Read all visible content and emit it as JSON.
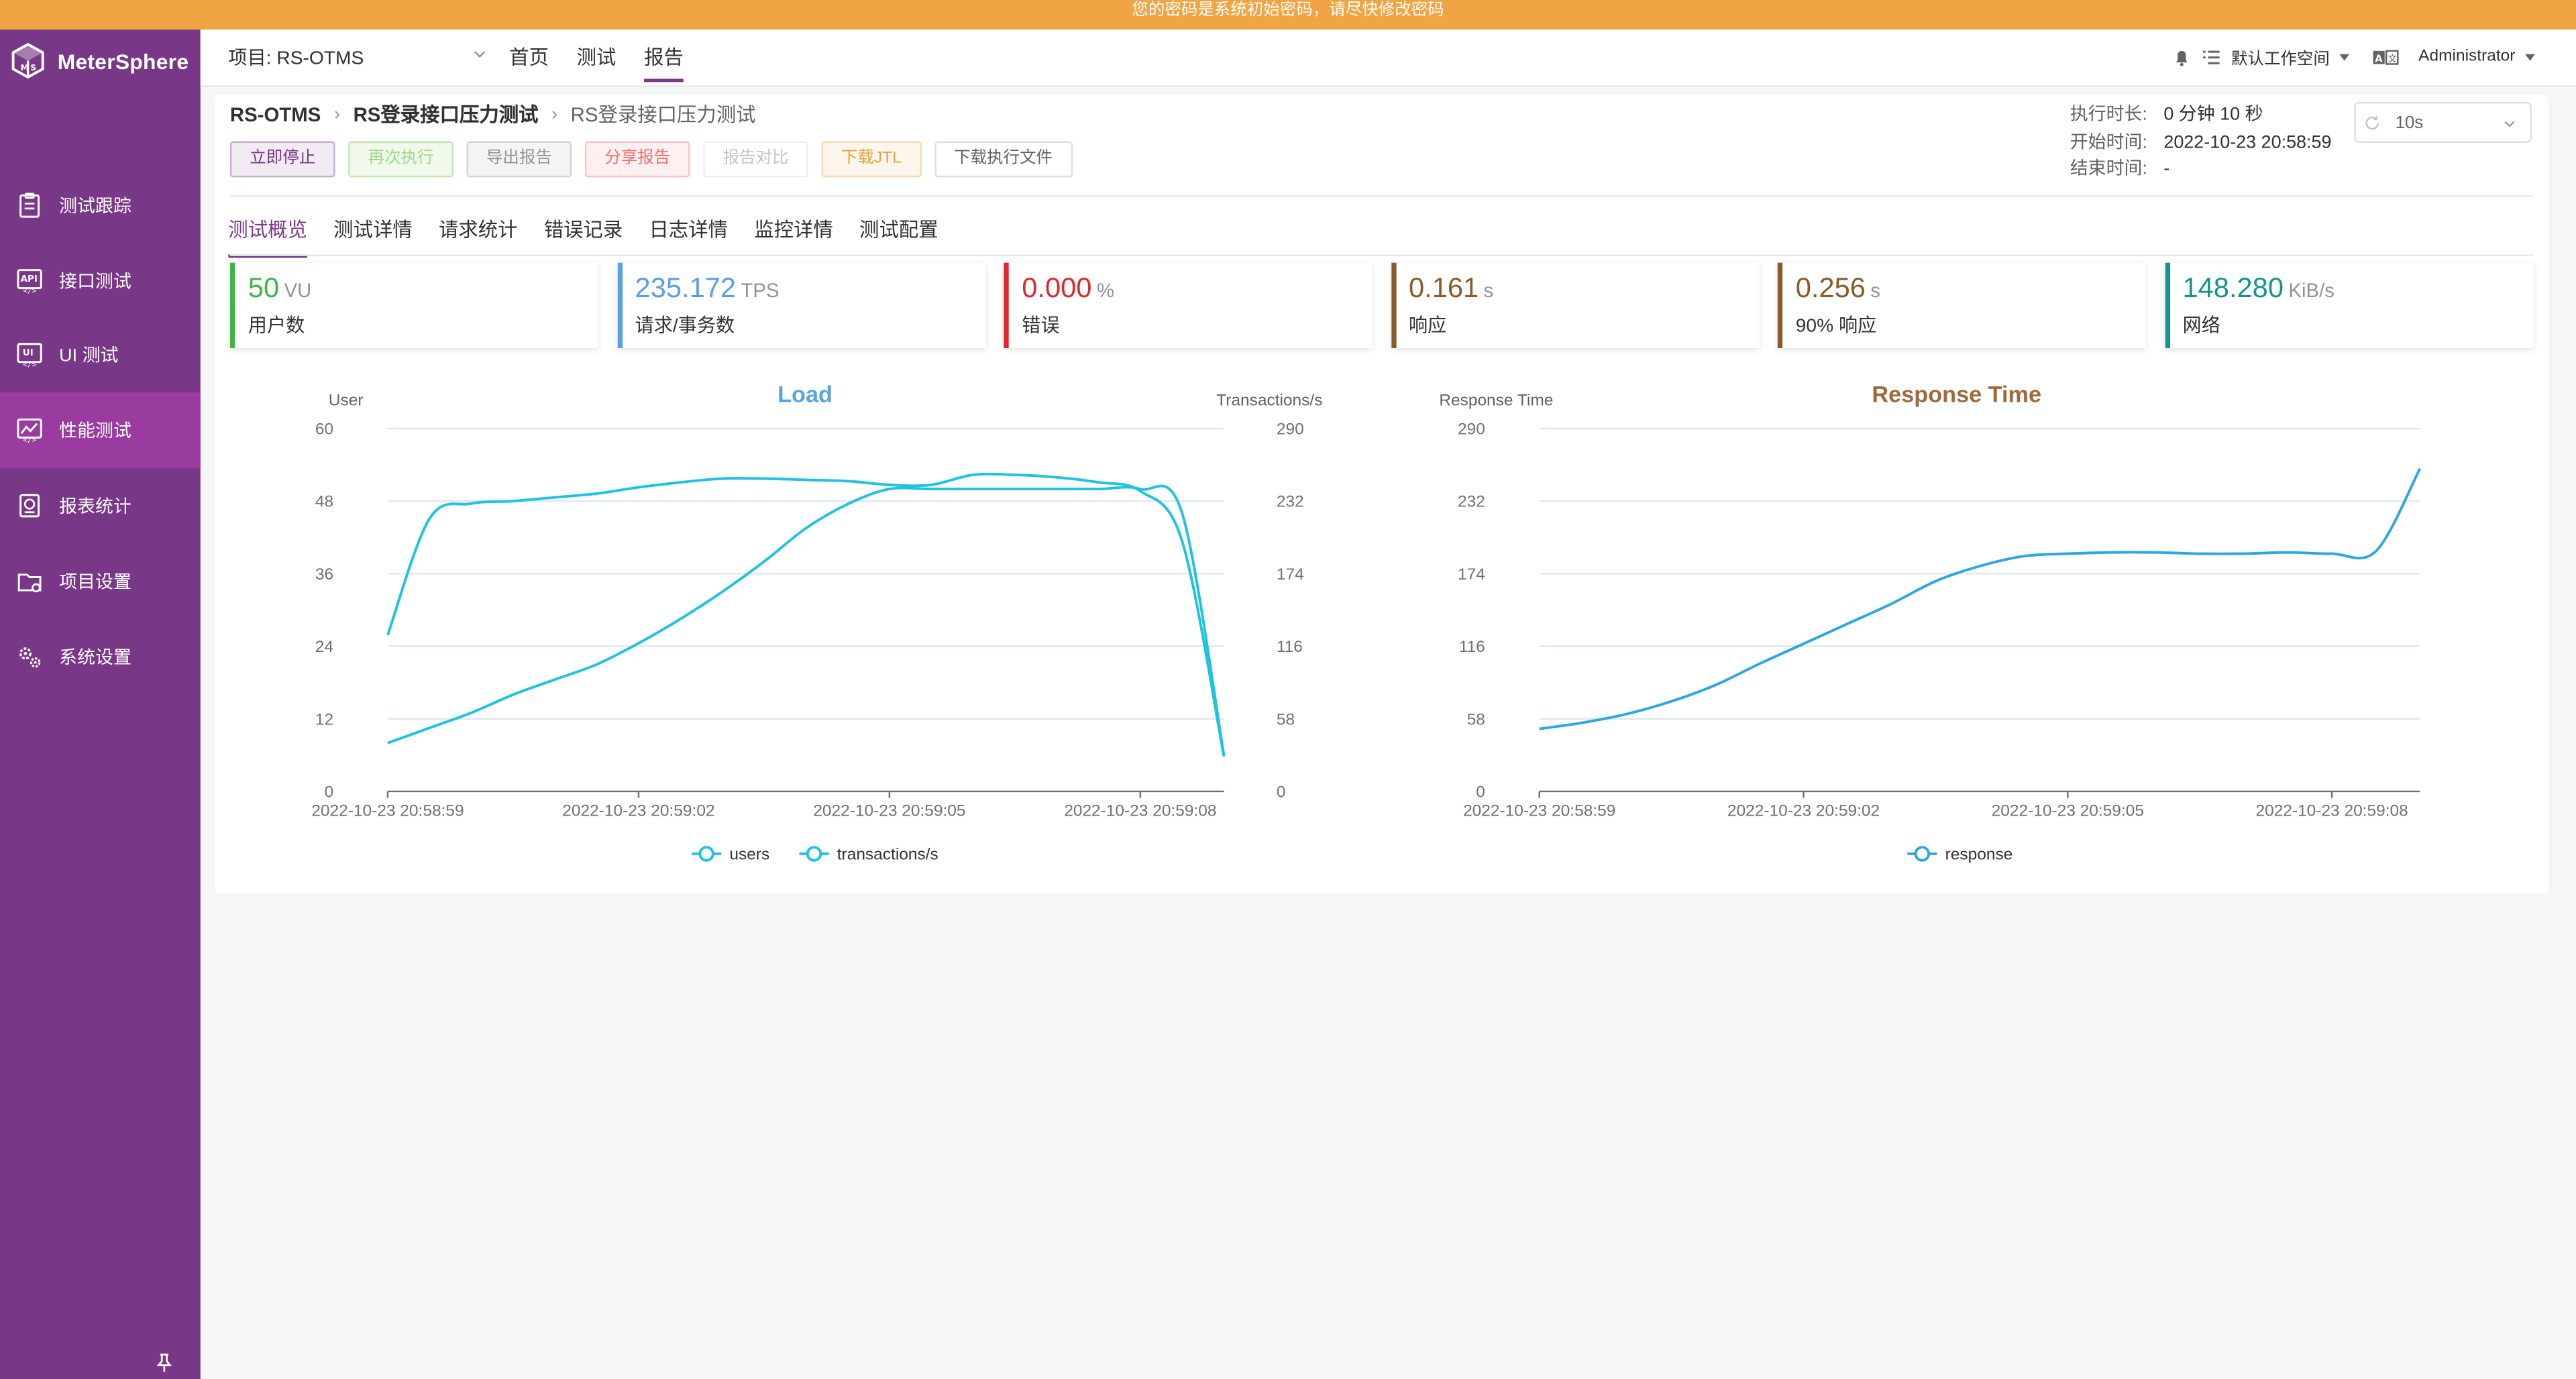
{
  "banner": "您的密码是系统初始密码，请尽快修改密码",
  "app": {
    "logo_text": "MeterSphere",
    "logo_icon": "metersphere-cube-logo"
  },
  "sidebar": {
    "items": [
      {
        "label": "测试跟踪",
        "icon": "clipboard-list-icon",
        "active": false
      },
      {
        "label": "接口测试",
        "icon": "api-icon",
        "active": false
      },
      {
        "label": "UI 测试",
        "icon": "ui-test-icon",
        "active": false
      },
      {
        "label": "性能测试",
        "icon": "performance-chart-icon",
        "active": true
      },
      {
        "label": "报表统计",
        "icon": "report-icon",
        "active": false
      },
      {
        "label": "项目设置",
        "icon": "project-folder-icon",
        "active": false
      },
      {
        "label": "系统设置",
        "icon": "gears-icon",
        "active": false
      }
    ],
    "pin_icon": "pin-icon"
  },
  "header": {
    "project_select": "项目: RS-OTMS",
    "nav": [
      "首页",
      "测试",
      "报告"
    ],
    "nav_active": 2,
    "workspace": "默认工作空间",
    "user": "Administrator"
  },
  "report": {
    "breadcrumb": [
      "RS-OTMS",
      "RS登录接口压力测试",
      "RS登录接口压力测试"
    ],
    "actions": {
      "stop": "立即停止",
      "rerun": "再次执行",
      "export": "导出报告",
      "share": "分享报告",
      "compare": "报告对比",
      "download_jtl": "下载JTL",
      "download_files": "下载执行文件"
    },
    "exec": {
      "duration_label": "执行时长:",
      "duration": "0 分钟 10 秒",
      "start_label": "开始时间:",
      "start": "2022-10-23 20:58:59",
      "end_label": "结束时间:",
      "end": "-"
    },
    "refresh_interval": "10s",
    "tabs": [
      "测试概览",
      "测试详情",
      "请求统计",
      "错误记录",
      "日志详情",
      "监控详情",
      "测试配置"
    ],
    "tab_active": 0,
    "cards": [
      {
        "value": "50",
        "unit": "VU",
        "label": "用户数",
        "color": "#44b349"
      },
      {
        "value": "235.172",
        "unit": "TPS",
        "label": "请求/事务数",
        "color": "#5a9ee6"
      },
      {
        "value": "0.000",
        "unit": "%",
        "label": "错误",
        "color": "#e1262e"
      },
      {
        "value": "0.161",
        "unit": "s",
        "label": "响应",
        "color": "#8b5a2b"
      },
      {
        "value": "0.256",
        "unit": "s",
        "label": "90% 响应",
        "color": "#8b5a2b"
      },
      {
        "value": "148.280",
        "unit": "KiB/s",
        "label": "网络",
        "color": "#14948d"
      }
    ]
  },
  "chart_data": [
    {
      "type": "line",
      "title": "Load",
      "title_color": "#5aa3e0",
      "ylabel_left": "User",
      "ylabel_right": "Transactions/s",
      "ylim_left": [
        0,
        60
      ],
      "ylim_right": [
        0,
        290
      ],
      "yticks_left": [
        "0",
        "12",
        "24",
        "36",
        "48",
        "60"
      ],
      "yticks_right": [
        "0",
        "58",
        "116",
        "174",
        "232",
        "290"
      ],
      "xticks": [
        "2022-10-23 20:58:59",
        "2022-10-23 20:59:02",
        "2022-10-23 20:59:05",
        "2022-10-23 20:59:08"
      ],
      "x": [
        0,
        0.5,
        1,
        1.5,
        2,
        2.5,
        3,
        3.5,
        4,
        4.5,
        5,
        5.5,
        6,
        6.5,
        7,
        7.5,
        8,
        8.5,
        9,
        9.5,
        10
      ],
      "series": [
        {
          "name": "users",
          "axis": "left",
          "color": "#1fc3dd",
          "values": [
            8,
            10.5,
            13,
            16,
            18.5,
            21,
            24.5,
            28.5,
            33,
            38,
            43.5,
            47.5,
            50,
            50,
            50,
            50,
            50,
            50,
            50,
            46,
            6
          ]
        },
        {
          "name": "transactions/s",
          "axis": "right",
          "color": "#1fc3dd",
          "values": [
            125,
            218,
            230,
            232,
            235,
            238,
            243,
            247,
            250,
            250,
            249,
            248,
            245,
            245,
            253,
            253,
            251,
            247,
            240,
            200,
            28
          ]
        }
      ],
      "legend": [
        "users",
        "transactions/s"
      ],
      "legend_position": "bottom"
    },
    {
      "type": "line",
      "title": "Response Time",
      "title_color": "#9c6b3c",
      "ylabel_left": "Response Time",
      "ylim_left": [
        0,
        290
      ],
      "yticks_left": [
        "0",
        "58",
        "116",
        "174",
        "232",
        "290"
      ],
      "xticks": [
        "2022-10-23 20:58:59",
        "2022-10-23 20:59:02",
        "2022-10-23 20:59:05",
        "2022-10-23 20:59:08"
      ],
      "x": [
        0,
        0.5,
        1,
        1.5,
        2,
        2.5,
        3,
        3.5,
        4,
        4.5,
        5,
        5.5,
        6,
        6.5,
        7,
        7.5,
        8,
        8.5,
        9,
        9.5,
        10
      ],
      "series": [
        {
          "name": "response",
          "axis": "left",
          "color": "#2da7e0",
          "values": [
            50,
            55,
            62,
            72,
            85,
            102,
            118,
            134,
            150,
            168,
            180,
            188,
            190,
            191,
            191,
            190,
            190,
            191,
            190,
            192,
            258
          ]
        }
      ],
      "legend": [
        "response"
      ],
      "legend_position": "bottom"
    }
  ]
}
